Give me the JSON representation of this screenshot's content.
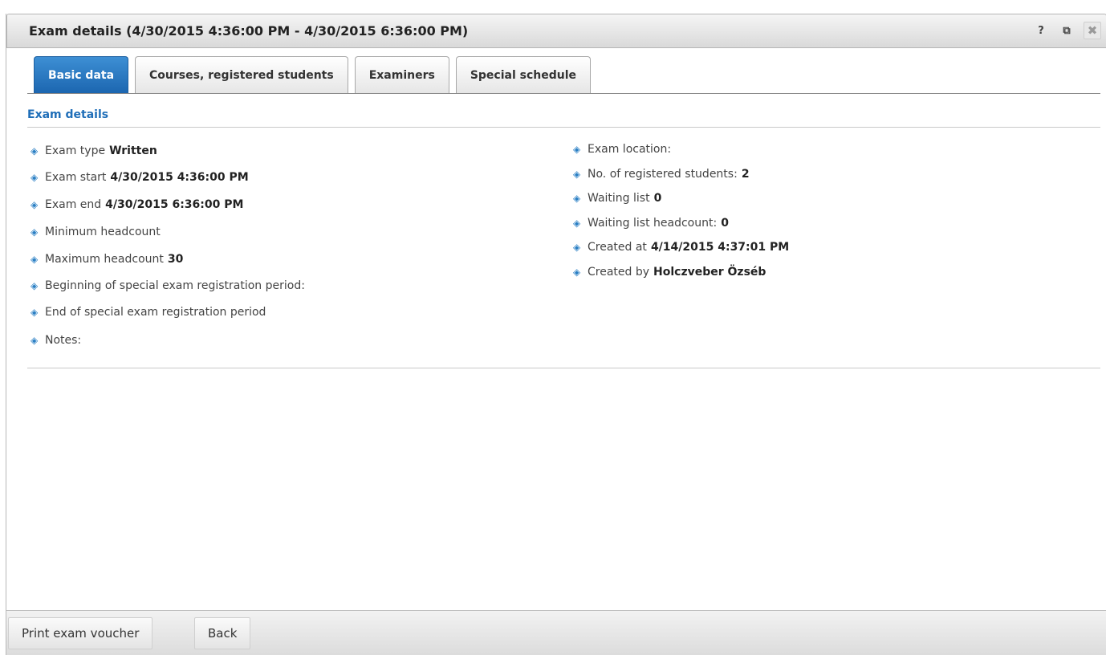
{
  "window": {
    "title": "Exam details (4/30/2015 4:36:00 PM - 4/30/2015 6:36:00 PM)",
    "help_glyph": "?",
    "popout_glyph": "⧉",
    "close_glyph": "✖"
  },
  "tabs": [
    {
      "label": "Basic data",
      "active": true
    },
    {
      "label": "Courses, registered students",
      "active": false
    },
    {
      "label": "Examiners",
      "active": false
    },
    {
      "label": "Special schedule",
      "active": false
    }
  ],
  "section": {
    "title": "Exam details"
  },
  "bullet_glyph": "◈",
  "left_fields": [
    {
      "label": "Exam type",
      "value": "Written"
    },
    {
      "label": "Exam start",
      "value": "4/30/2015 4:36:00 PM"
    },
    {
      "label": "Exam end",
      "value": "4/30/2015 6:36:00 PM"
    },
    {
      "label": "Minimum headcount",
      "value": ""
    },
    {
      "label": "Maximum headcount",
      "value": "30"
    },
    {
      "label": "Beginning of special exam registration period:",
      "value": ""
    },
    {
      "label": "End of special exam registration period",
      "value": ""
    },
    {
      "label": "Notes:",
      "value": ""
    }
  ],
  "right_fields": [
    {
      "label": "Exam location:",
      "value": ""
    },
    {
      "label": "No. of registered students:",
      "value": "2"
    },
    {
      "label": "Waiting list",
      "value": "0"
    },
    {
      "label": "Waiting list headcount:",
      "value": "0"
    },
    {
      "label": "Created at",
      "value": "4/14/2015 4:37:01 PM"
    },
    {
      "label": "Created by",
      "value": "Holczveber Özséb"
    }
  ],
  "footer": {
    "print_label": "Print exam voucher",
    "back_label": "Back"
  },
  "colors": {
    "accent": "#1f6eb8",
    "active_tab": "#2a79c2"
  }
}
